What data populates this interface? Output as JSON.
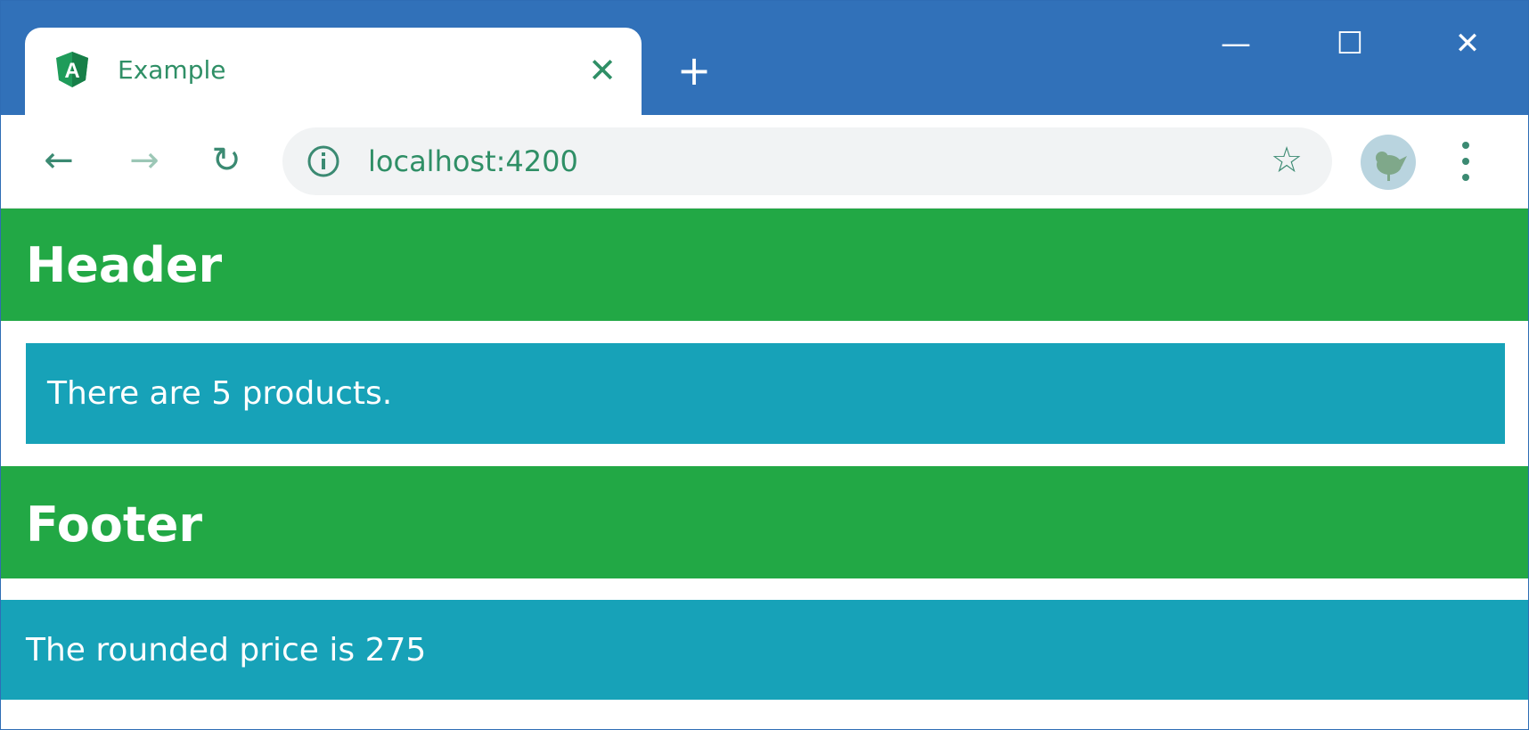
{
  "browser": {
    "tab": {
      "title": "Example",
      "favicon": "angular-logo-icon",
      "close_icon": "close-icon"
    },
    "new_tab_icon": "plus-icon",
    "window_controls": [
      "minimize-icon",
      "maximize-icon",
      "close-icon"
    ],
    "address": {
      "url": "localhost:4200",
      "info_icon": "info-icon",
      "bookmark_icon": "star-icon"
    },
    "nav_icons": [
      "back-arrow-icon",
      "forward-arrow-icon",
      "reload-icon"
    ],
    "menu_icon": "kebab-menu-icon",
    "colors": {
      "titlebar": "#3171b9",
      "tab_text": "#2f8f66"
    }
  },
  "page": {
    "header": "Header",
    "info_message": "There are 5 products.",
    "footer": "Footer",
    "price_message": "The rounded price is 275",
    "colors": {
      "success": "#22a845",
      "info": "#17a2b8"
    }
  }
}
